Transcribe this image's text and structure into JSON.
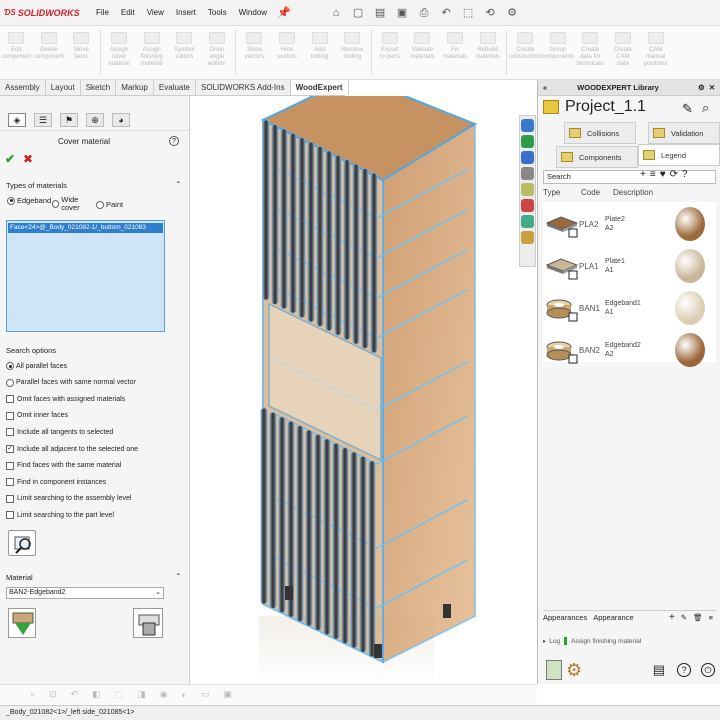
{
  "app": {
    "logo": "SOLIDWORKS"
  },
  "menu": [
    "File",
    "Edit",
    "View",
    "Insert",
    "Tools",
    "Window"
  ],
  "ribbon": [
    "Edit\ncomponent",
    "Delete\ncomponent",
    "Move\nfaces",
    "Assign\ncover\nmaterial",
    "Assign\nfinishing\nmaterial",
    "Symbol\nedition",
    "Grain\nangle\nedition",
    "Show\nvectors",
    "Hide\nvectors",
    "Add\ntooling",
    "Remove\ntooling",
    "Export\nto parts",
    "Validate\nmaterials",
    "Fix\nmaterials",
    "Rebuild\nmaterials",
    "Create\nconstruction",
    "Group\ncomponents",
    "Create\ndata for\ntechnicals",
    "Create\nCAM\ndata",
    "CAM\nmanual\npositions"
  ],
  "cmdtabs": [
    "Assembly",
    "Layout",
    "Sketch",
    "Markup",
    "Evaluate",
    "SOLIDWORKS Add-Ins",
    "WoodExpert"
  ],
  "panel": {
    "title": "Cover material",
    "types_header": "Types of materials",
    "types": [
      "Edgeband",
      "Wide cover",
      "Paint"
    ],
    "selected_face": "Face<24>@_Body_021082-1/_bottom_021083",
    "search_header": "Search options",
    "search_options": [
      {
        "label": "All parallel faces",
        "kind": "radio",
        "on": true
      },
      {
        "label": "Parallel faces with same normal vector",
        "kind": "radio",
        "on": false
      },
      {
        "label": "Omit faces with assigned materials",
        "kind": "check",
        "on": false
      },
      {
        "label": "Omit inner faces",
        "kind": "check",
        "on": false
      },
      {
        "label": "Include all tangents to selected",
        "kind": "check",
        "on": false
      },
      {
        "label": "Include all adjacent to the selected one",
        "kind": "check",
        "on": true
      },
      {
        "label": "Find faces with the same material",
        "kind": "check",
        "on": false
      },
      {
        "label": "Find in component instances",
        "kind": "check",
        "on": false
      },
      {
        "label": "Limit searching to the assembly level",
        "kind": "check",
        "on": false
      },
      {
        "label": "Limit searching to the part level",
        "kind": "check",
        "on": false
      }
    ],
    "material_header": "Material",
    "material_value": "BAN2-Edgeband2"
  },
  "library": {
    "header": "WOODEXPERT Library",
    "project": "Project_1.1",
    "tabs": [
      "Collisions",
      "Validation",
      "Components",
      "Legend"
    ],
    "search_label": "Search",
    "columns": [
      "Type",
      "Code",
      "Description"
    ],
    "rows": [
      {
        "code": "PLA2",
        "name": "Plate2",
        "sub": "A2",
        "kind": "plate",
        "color": "#9b6a3a"
      },
      {
        "code": "PLA1",
        "name": "Plate1",
        "sub": "A1",
        "kind": "plate",
        "color": "#c9b699"
      },
      {
        "code": "BAN1",
        "name": "Edgeband1",
        "sub": "A1",
        "kind": "band",
        "color": "#dccdb4"
      },
      {
        "code": "BAN2",
        "name": "Edgeband2",
        "sub": "A2",
        "kind": "band",
        "color": "#9a6537"
      }
    ],
    "bottom_tabs": [
      "Appearances",
      "Appearance"
    ],
    "log_label": "Log",
    "log_text": "Assign finishing material"
  },
  "status": "_Body_021082<1>/_left side_021085<1>"
}
